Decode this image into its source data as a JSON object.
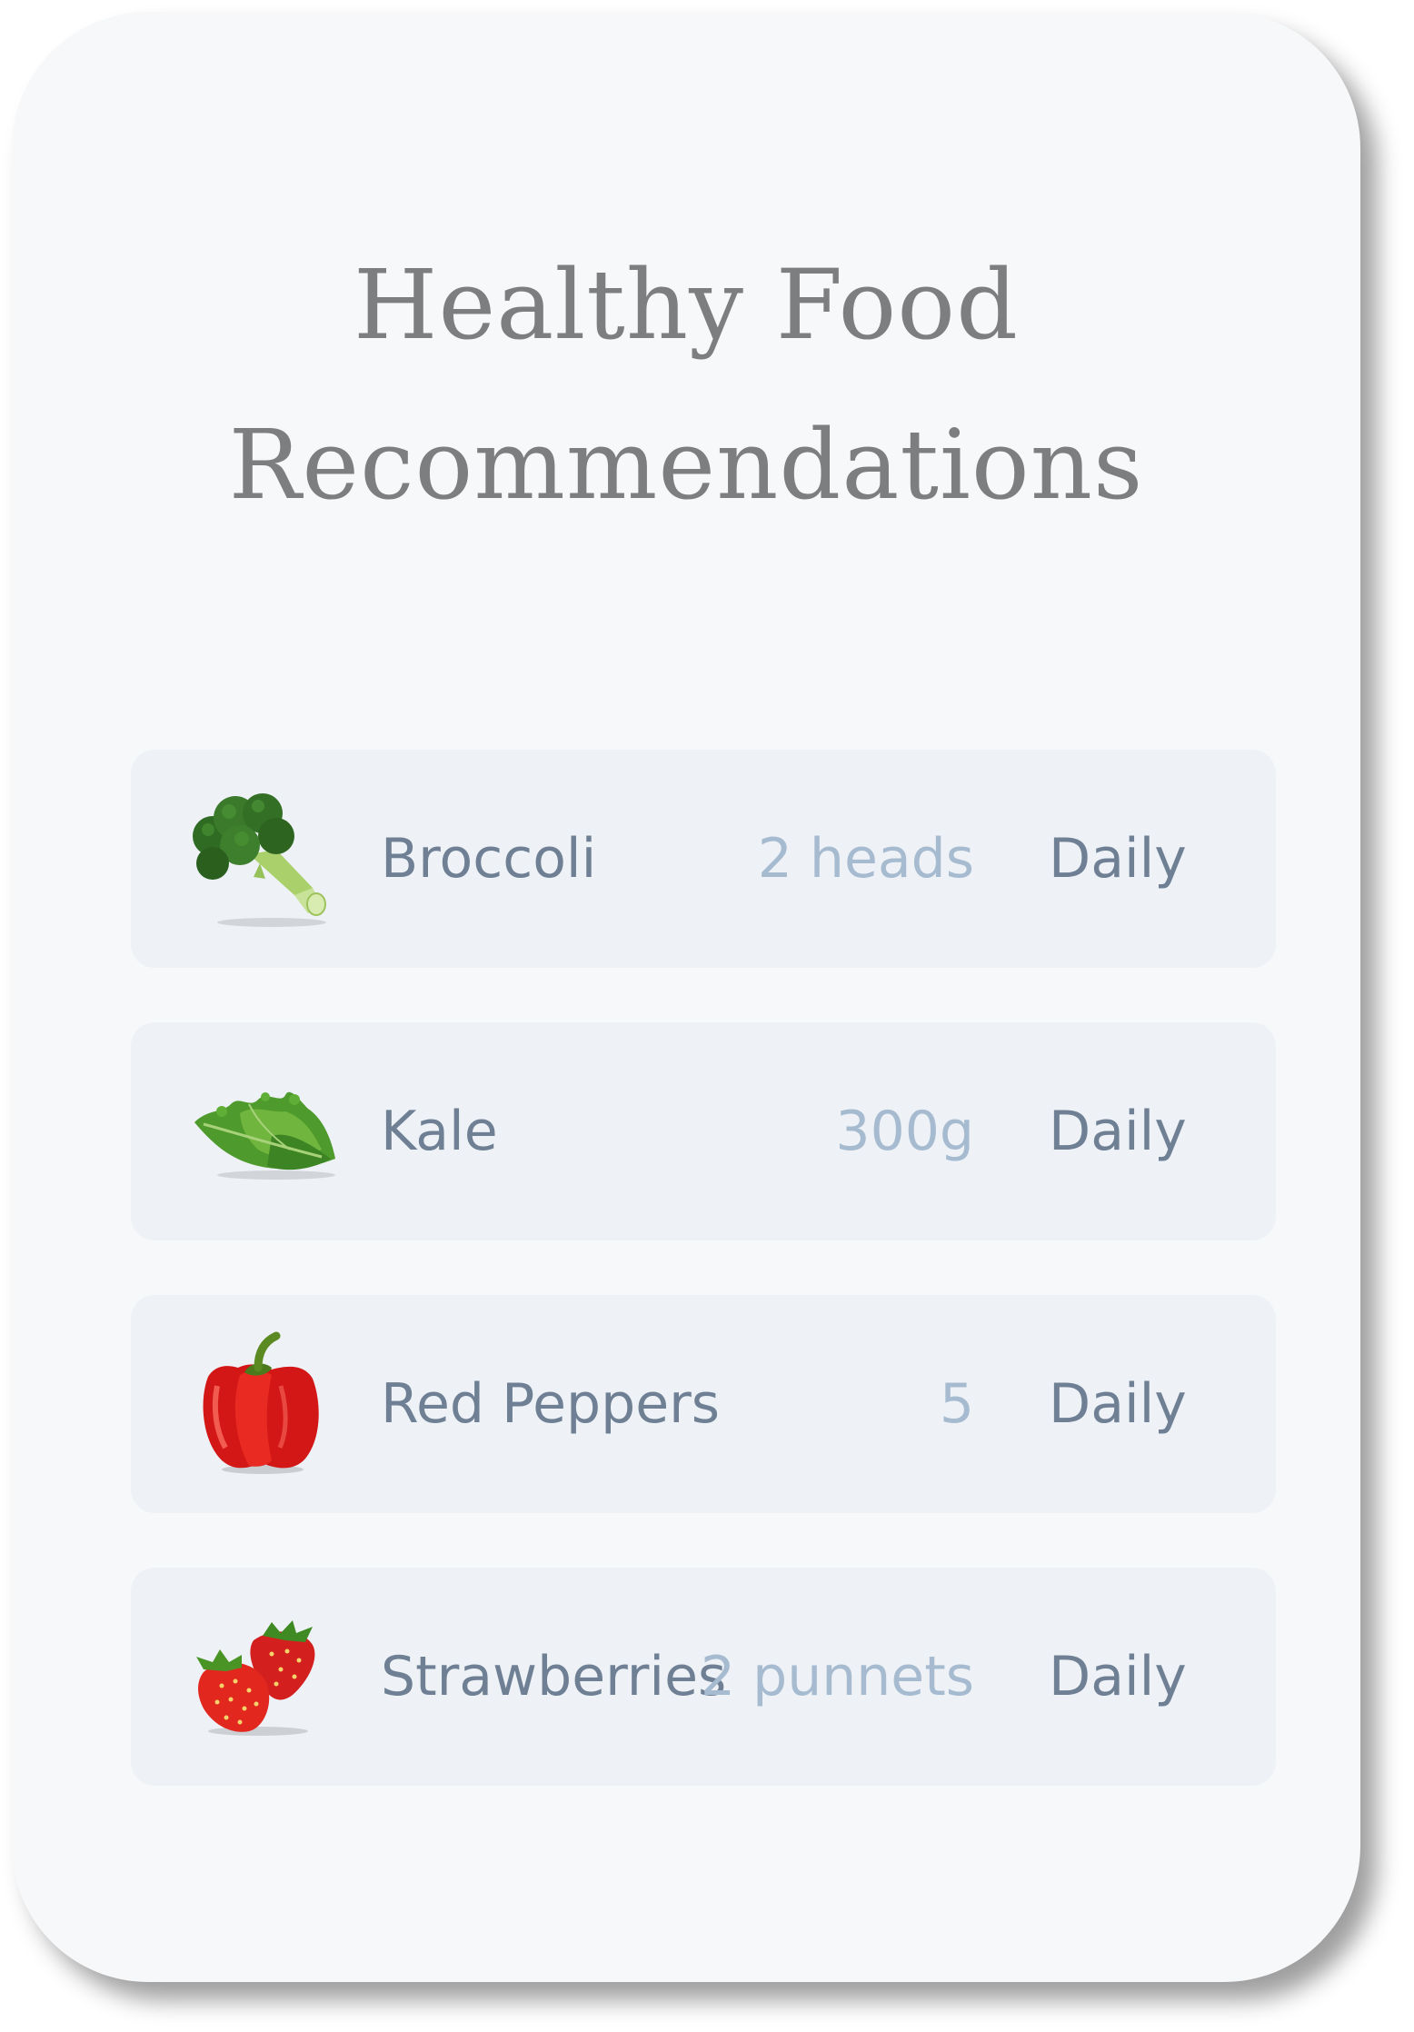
{
  "header": {
    "title_line1": "Healthy Food",
    "title_line2": "Recommendations"
  },
  "items": [
    {
      "icon": "broccoli-icon",
      "name": "Broccoli",
      "quantity": "2 heads",
      "frequency": "Daily"
    },
    {
      "icon": "kale-icon",
      "name": "Kale",
      "quantity": "300g",
      "frequency": "Daily"
    },
    {
      "icon": "red-pepper-icon",
      "name": "Red Peppers",
      "quantity": "5",
      "frequency": "Daily"
    },
    {
      "icon": "strawberries-icon",
      "name": "Strawberries",
      "quantity": "2 punnets",
      "frequency": "Daily"
    }
  ],
  "colors": {
    "card_background": "#f7f8fa",
    "row_background": "#eef2f7",
    "title": "#7d7e80",
    "name_text": "#6f8094",
    "quantity_text": "#a7bbd0"
  }
}
